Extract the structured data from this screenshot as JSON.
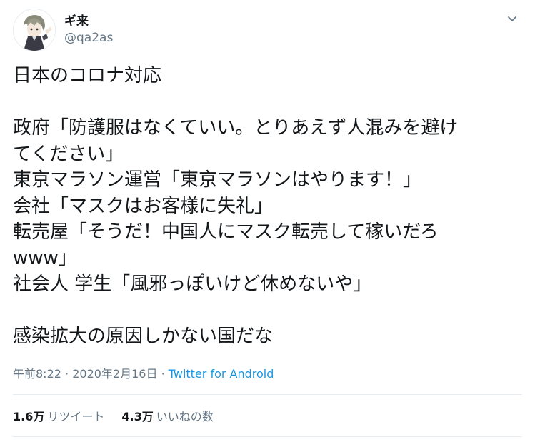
{
  "user": {
    "display_name": "ギ来",
    "handle": "@qa2as",
    "avatar_icon": "anime-character-avatar"
  },
  "tweet": {
    "lines": [
      "日本のコロナ対応",
      "",
      "政府「防護服はなくていい。とりあえず人混みを避け",
      "てください」",
      "東京マラソン運営「東京マラソンはやります！」",
      "会社「マスクはお客様に失礼」",
      "転売屋「そうだ！中国人にマスク転売して稼いだろ",
      "www」",
      "社会人 学生「風邪っぽいけど休めないや」",
      "",
      "感染拡大の原因しかない国だな"
    ]
  },
  "meta": {
    "time": "午前8:22",
    "separator": "·",
    "date": "2020年2月16日",
    "source": "Twitter for Android"
  },
  "stats": {
    "retweets_count": "1.6万",
    "retweets_label": "リツイート",
    "likes_count": "4.3万",
    "likes_label": "いいねの数"
  },
  "colors": {
    "text": "#14171a",
    "secondary": "#657786",
    "link": "#1b95e0",
    "divider": "#e6ecf0"
  },
  "icons": {
    "more": "chevron-down-icon"
  }
}
